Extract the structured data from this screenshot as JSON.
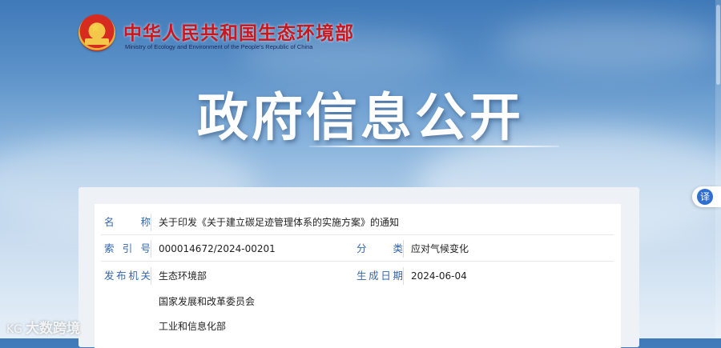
{
  "header": {
    "org_name_cn": "中华人民共和国生态环境部",
    "org_name_en": "Ministry of Ecology and Environment of the People's Republic of China",
    "emblem_icon": "national-emblem-icon"
  },
  "banner": {
    "title": "政府信息公开"
  },
  "info": {
    "name_label": "名　称",
    "name_value": "关于印发《关于建立碳足迹管理体系的实施方案》的通知",
    "index_label": "索 引 号",
    "index_value": "000014672/2024-00201",
    "category_label": "分　类",
    "category_value": "应对气候变化",
    "issuer_label": "发布机关",
    "issuers": [
      "生态环境部",
      "国家发展和改革委员会",
      "工业和信息化部"
    ],
    "date_label": "生成日期",
    "date_value": "2024-06-04"
  },
  "side_tab": {
    "label": "译"
  },
  "watermark": {
    "text": "大数跨境",
    "glyph": "KG"
  },
  "colors": {
    "label_blue": "#3566ad",
    "title_red": "#c8171e",
    "badge_blue": "#2f6fd0"
  }
}
